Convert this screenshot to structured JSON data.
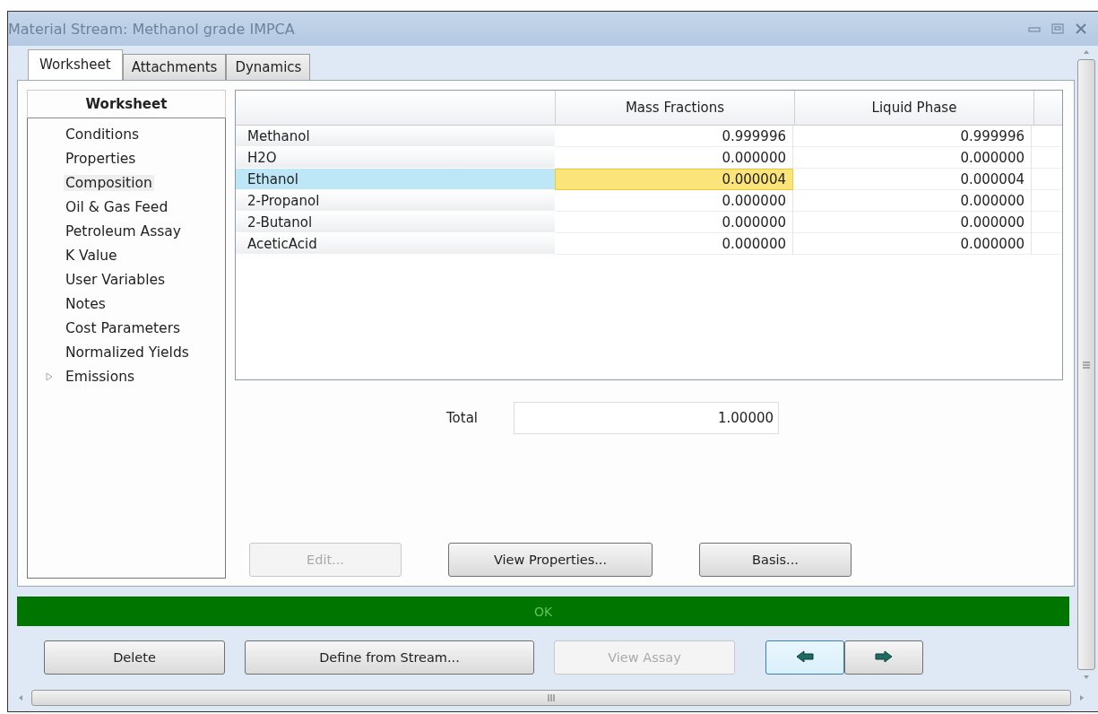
{
  "window": {
    "title": "Material Stream: Methanol grade IMPCA"
  },
  "tabs": [
    {
      "label": "Worksheet",
      "selected": true
    },
    {
      "label": "Attachments",
      "selected": false
    },
    {
      "label": "Dynamics",
      "selected": false
    }
  ],
  "sidebar": {
    "title": "Worksheet",
    "items": [
      {
        "label": "Conditions",
        "selected": false
      },
      {
        "label": "Properties",
        "selected": false
      },
      {
        "label": "Composition",
        "selected": true
      },
      {
        "label": "Oil & Gas Feed",
        "selected": false
      },
      {
        "label": "Petroleum Assay",
        "selected": false
      },
      {
        "label": "K Value",
        "selected": false
      },
      {
        "label": "User Variables",
        "selected": false
      },
      {
        "label": "Notes",
        "selected": false
      },
      {
        "label": "Cost Parameters",
        "selected": false
      },
      {
        "label": "Normalized Yields",
        "selected": false
      },
      {
        "label": "Emissions",
        "selected": false,
        "expandable": true,
        "expanded": false
      }
    ]
  },
  "table": {
    "columns": [
      "Mass Fractions",
      "Liquid Phase"
    ],
    "rows": [
      {
        "name": "Methanol",
        "selected": false,
        "cells": [
          {
            "value": "0.999996",
            "focused": false
          },
          {
            "value": "0.999996",
            "focused": false
          }
        ]
      },
      {
        "name": "H2O",
        "selected": false,
        "cells": [
          {
            "value": "0.000000",
            "focused": false
          },
          {
            "value": "0.000000",
            "focused": false
          }
        ]
      },
      {
        "name": "Ethanol",
        "selected": true,
        "cells": [
          {
            "value": "0.000004",
            "focused": true
          },
          {
            "value": "0.000004",
            "focused": false
          }
        ]
      },
      {
        "name": "2-Propanol",
        "selected": false,
        "cells": [
          {
            "value": "0.000000",
            "focused": false
          },
          {
            "value": "0.000000",
            "focused": false
          }
        ]
      },
      {
        "name": "2-Butanol",
        "selected": false,
        "cells": [
          {
            "value": "0.000000",
            "focused": false
          },
          {
            "value": "0.000000",
            "focused": false
          }
        ]
      },
      {
        "name": "AceticAcid",
        "selected": false,
        "cells": [
          {
            "value": "0.000000",
            "focused": false
          },
          {
            "value": "0.000000",
            "focused": false
          }
        ]
      }
    ]
  },
  "total": {
    "label": "Total",
    "value": "1.00000"
  },
  "panel_buttons": [
    {
      "label": "Edit...",
      "disabled": true
    },
    {
      "label": "View Properties...",
      "disabled": false
    },
    {
      "label": "Basis...",
      "disabled": false
    }
  ],
  "status_bar": {
    "text": "OK"
  },
  "bottom_buttons": [
    {
      "label": "Delete",
      "disabled": false
    },
    {
      "label": "Define from Stream...",
      "disabled": false
    },
    {
      "label": "View Assay",
      "disabled": true
    }
  ],
  "nav_arrows": [
    {
      "kind": "left",
      "focused": true
    },
    {
      "kind": "right",
      "focused": false
    }
  ]
}
